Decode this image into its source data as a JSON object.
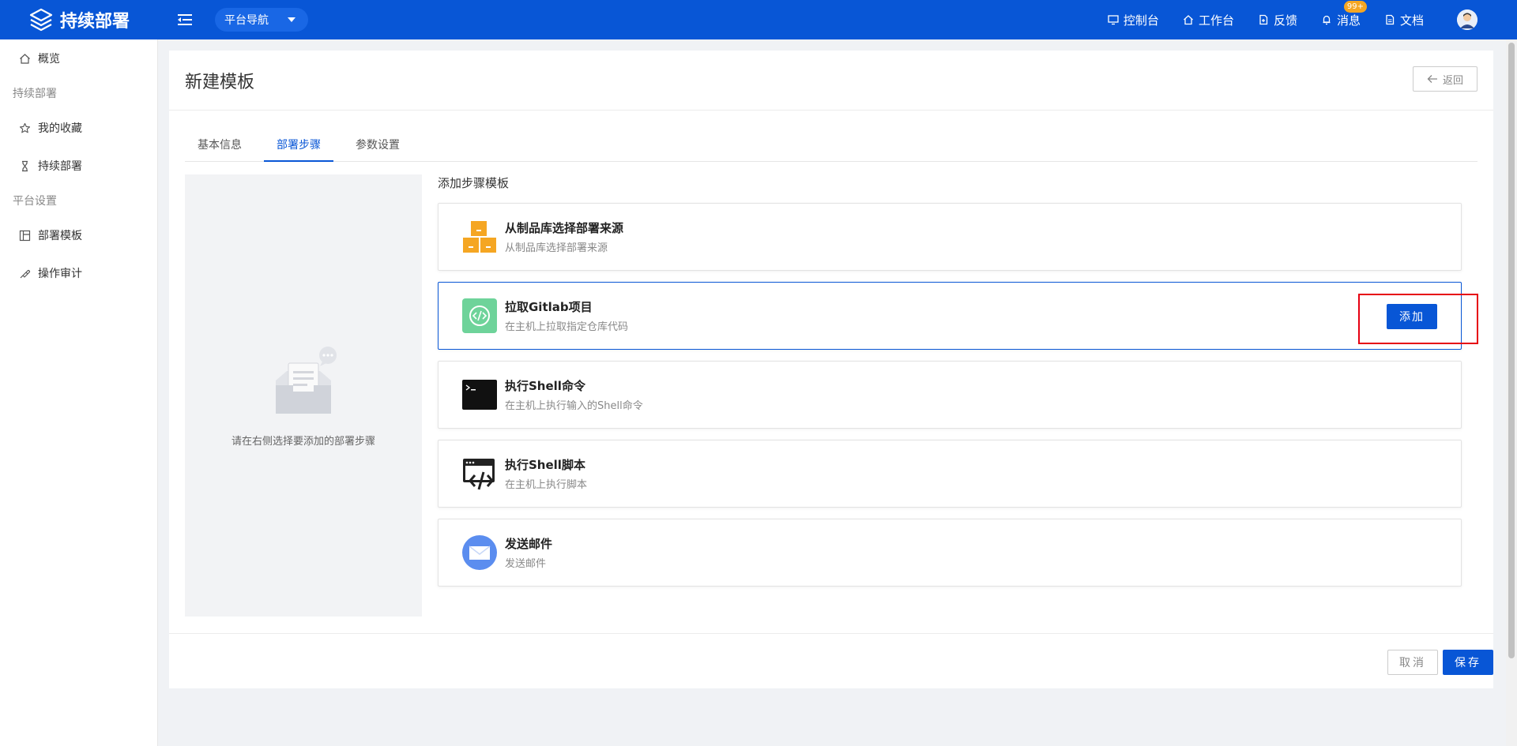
{
  "app": {
    "title": "持续部署",
    "platform_nav_label": "平台导航"
  },
  "topbar": {
    "links": [
      {
        "label": "控制台",
        "icon": "monitor-icon"
      },
      {
        "label": "工作台",
        "icon": "home-icon"
      },
      {
        "label": "反馈",
        "icon": "feedback-icon"
      },
      {
        "label": "消息",
        "icon": "bell-icon"
      },
      {
        "label": "文档",
        "icon": "document-icon"
      }
    ],
    "message_badge": "99+"
  },
  "sidebar": {
    "overview": "概览",
    "group1": "持续部署",
    "favorites": "我的收藏",
    "deploy": "持续部署",
    "group2": "平台设置",
    "templates": "部署模板",
    "audit": "操作审计"
  },
  "page": {
    "title": "新建模板",
    "back_label": "返回",
    "tabs": [
      "基本信息",
      "部署步骤",
      "参数设置"
    ],
    "active_tab": "部署步骤",
    "empty_hint": "请在右侧选择要添加的部署步骤",
    "templates_title": "添加步骤模板",
    "templates": [
      {
        "name": "从制品库选择部署来源",
        "desc": "从制品库选择部署来源",
        "icon": "artifact-boxes-icon"
      },
      {
        "name": "拉取Gitlab项目",
        "desc": "在主机上拉取指定仓库代码",
        "icon": "gitlab-code-icon"
      },
      {
        "name": "执行Shell命令",
        "desc": "在主机上执行输入的Shell命令",
        "icon": "terminal-icon"
      },
      {
        "name": "执行Shell脚本",
        "desc": "在主机上执行脚本",
        "icon": "script-icon"
      },
      {
        "name": "发送邮件",
        "desc": "发送邮件",
        "icon": "mail-icon"
      }
    ],
    "add_label": "添加",
    "cancel_label": "取消",
    "save_label": "保存"
  },
  "colors": {
    "primary": "#0856d6",
    "highlight": "#e60012",
    "badge": "#f5a623"
  }
}
